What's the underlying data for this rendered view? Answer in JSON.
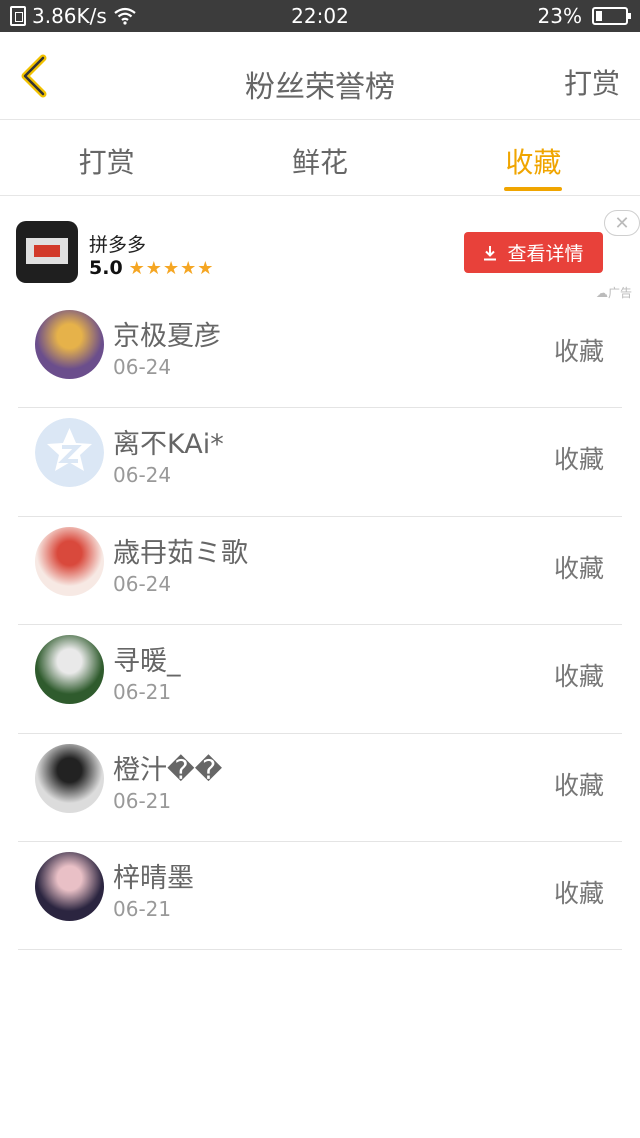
{
  "status_bar": {
    "speed": "3.86K/s",
    "time": "22:02",
    "battery_percent": "23%",
    "battery_level": 0.23
  },
  "header": {
    "title": "粉丝荣誉榜",
    "action_label": "打赏"
  },
  "tabs": [
    {
      "label": "打赏",
      "active": false
    },
    {
      "label": "鲜花",
      "active": false
    },
    {
      "label": "收藏",
      "active": true
    }
  ],
  "ad": {
    "app_name": "拼多多",
    "rating": "5.0",
    "stars": "★★★★★",
    "button_label": "查看详情",
    "close_label": "✕",
    "tag": "广告"
  },
  "fans": [
    {
      "name": "京极夏彦",
      "date": "06-24",
      "action": "收藏",
      "avatar_colors": [
        "#6b4e8c",
        "#e6b24a"
      ]
    },
    {
      "name": "离不KAi*",
      "date": "06-24",
      "action": "收藏",
      "avatar_colors": [
        "#dbe7f5",
        "#ffffff"
      ]
    },
    {
      "name": "歳冄茹ミ歌",
      "date": "06-24",
      "action": "收藏",
      "avatar_colors": [
        "#f7e9e4",
        "#d9493c"
      ]
    },
    {
      "name": "寻暖_",
      "date": "06-21",
      "action": "收藏",
      "avatar_colors": [
        "#2f5b2d",
        "#e9e9e9"
      ]
    },
    {
      "name": "橙汁��",
      "date": "06-21",
      "action": "收藏",
      "avatar_colors": [
        "#dcdcdc",
        "#222222"
      ]
    },
    {
      "name": "梓晴墨",
      "date": "06-21",
      "action": "收藏",
      "avatar_colors": [
        "#2b2540",
        "#e9c0c6"
      ]
    }
  ],
  "colors": {
    "accent": "#f0a500",
    "ad_button": "#e8413a",
    "star": "#f5a623"
  }
}
